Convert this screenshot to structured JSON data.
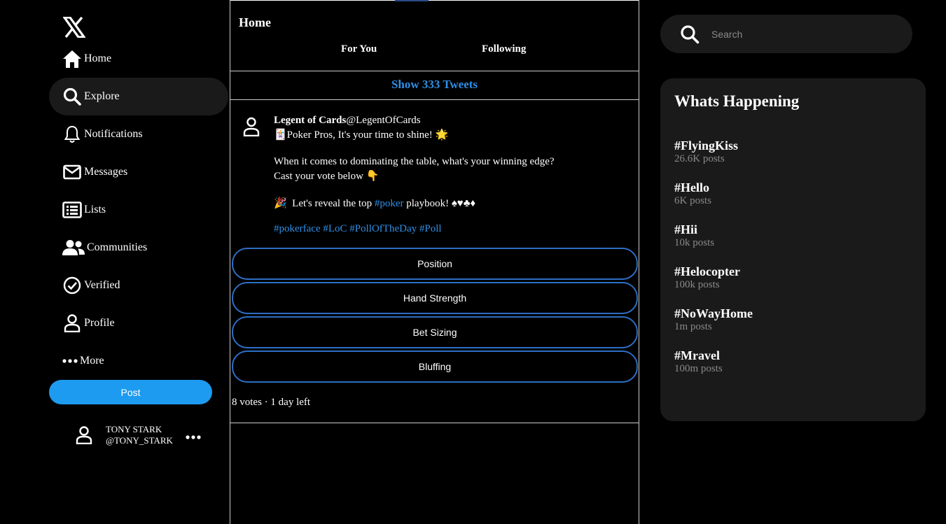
{
  "sidebar": {
    "logo": "x-logo-icon",
    "nav": [
      {
        "label": "Home",
        "icon": "home-icon"
      },
      {
        "label": "Explore",
        "icon": "search-icon"
      },
      {
        "label": "Notifications",
        "icon": "bell-icon"
      },
      {
        "label": "Messages",
        "icon": "envelope-icon"
      },
      {
        "label": "Lists",
        "icon": "list-icon"
      },
      {
        "label": "Communities",
        "icon": "people-icon"
      },
      {
        "label": "Verified",
        "icon": "check-circle-icon"
      },
      {
        "label": "Profile",
        "icon": "user-icon"
      },
      {
        "label": "More",
        "icon": "more-dots-icon"
      }
    ],
    "active": "Explore",
    "post_label": "Post",
    "account": {
      "name": "TONY STARK",
      "handle": "@TONY_STARK"
    }
  },
  "feed": {
    "title": "Home",
    "tabs": [
      {
        "label": "For You"
      },
      {
        "label": "Following"
      }
    ],
    "show_tweets": "Show 333 Tweets",
    "tweet": {
      "author": "Legent of Cards",
      "handle": "@LegentOfCards",
      "line1": "🃏Poker Pros, It's your time to shine!  🌟",
      "line2": "When it comes to dominating the table, what's your winning edge?",
      "line3": "Cast your vote below 👇",
      "line4_pre": "🎉  Let's reveal the top ",
      "line4_tag": "#poker",
      "line4_post": " playbook! ♠♥♣♦",
      "hashtags": "#pokerface #LoC #PollOfTheDay #Poll",
      "poll": [
        {
          "label": "Position"
        },
        {
          "label": "Hand Strength"
        },
        {
          "label": "Bet Sizing"
        },
        {
          "label": "Bluffing"
        }
      ],
      "poll_meta": "8 votes · 1 day left"
    }
  },
  "search": {
    "placeholder": "Search"
  },
  "trends": {
    "title": "Whats Happening",
    "items": [
      {
        "tag": "#FlyingKiss",
        "count": "26.6K posts"
      },
      {
        "tag": "#Hello",
        "count": "6K posts"
      },
      {
        "tag": "#Hii",
        "count": "10k posts"
      },
      {
        "tag": "#Helocopter",
        "count": "100k posts"
      },
      {
        "tag": "#NoWayHome",
        "count": "1m posts"
      },
      {
        "tag": "#Mravel",
        "count": "100m posts"
      }
    ]
  },
  "colors": {
    "accent": "#1d9bf0",
    "link": "#2f8fe6",
    "poll_border": "#2d6ec4",
    "panel": "#1a1a1a"
  }
}
